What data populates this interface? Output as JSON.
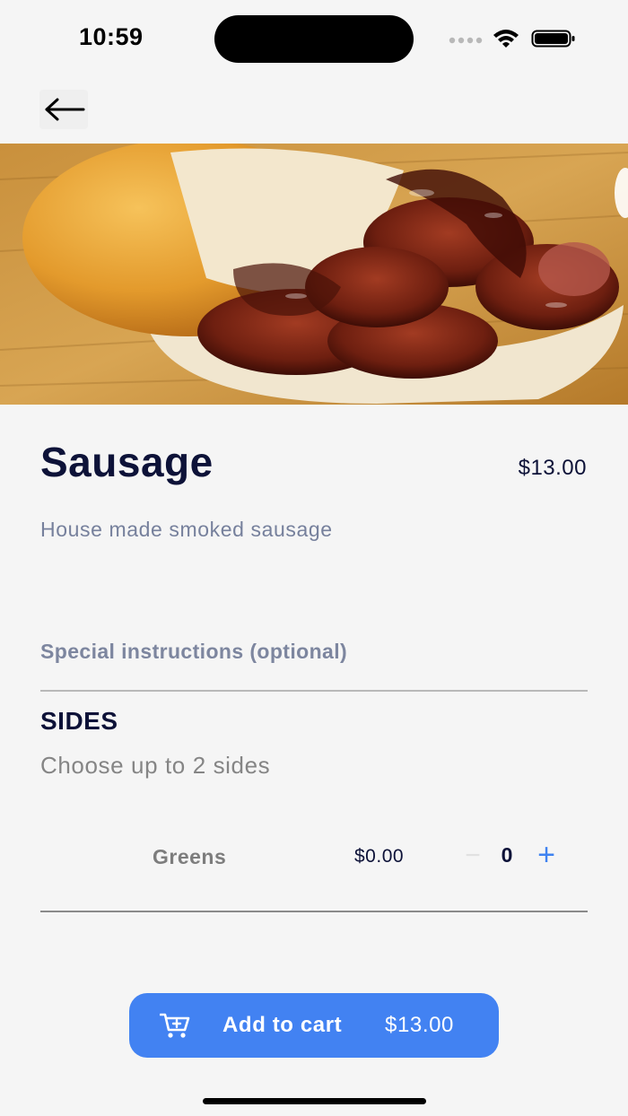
{
  "status_bar": {
    "time": "10:59"
  },
  "nav": {
    "back_icon": "arrow-left-icon"
  },
  "item": {
    "image_subject": "sausage-sandwich-photo",
    "title": "Sausage",
    "price": "$13.00",
    "description": "House made smoked sausage"
  },
  "special_instructions": {
    "label": "Special instructions (optional)"
  },
  "sides": {
    "title": "SIDES",
    "subtitle": "Choose up to 2 sides",
    "options": [
      {
        "name": "Greens",
        "price": "$0.00",
        "minus_label": "−",
        "quantity": "0",
        "plus_label": "+"
      }
    ]
  },
  "cart": {
    "icon": "cart-plus-icon",
    "label": "Add to cart",
    "price": "$13.00"
  },
  "colors": {
    "accent": "#4282f2",
    "title": "#0d1238",
    "muted": "#76809c",
    "background": "#f5f5f5"
  }
}
